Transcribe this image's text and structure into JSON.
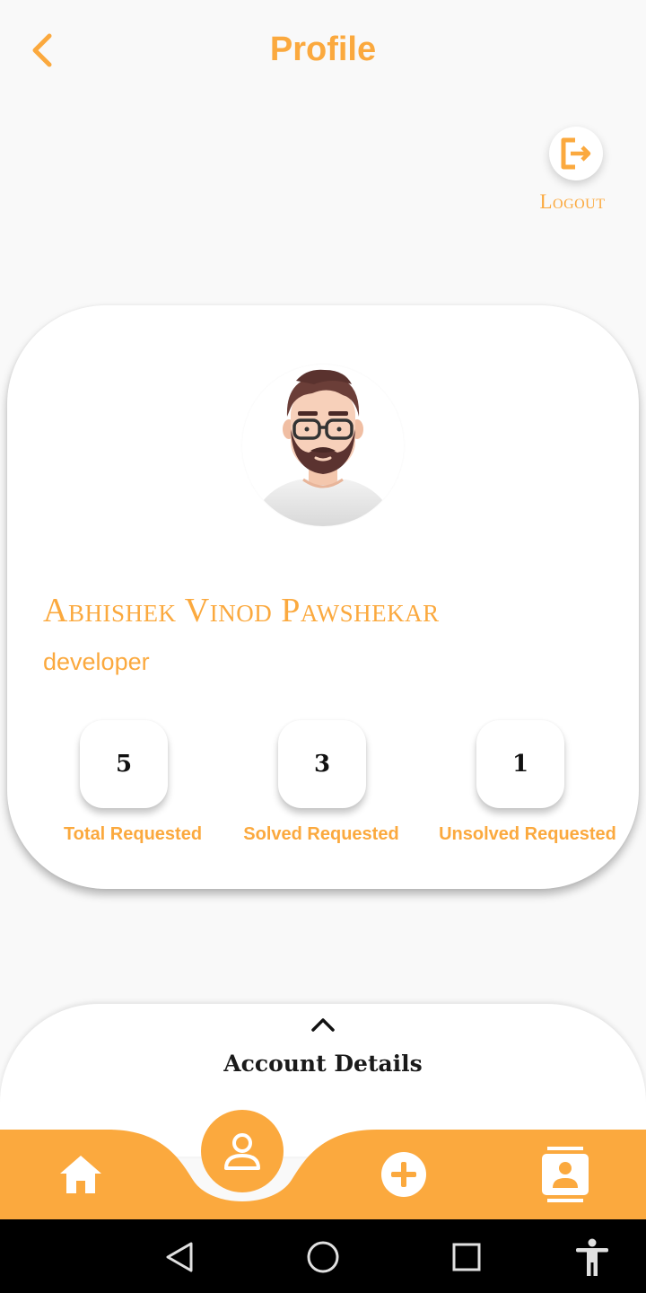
{
  "header": {
    "title": "Profile",
    "back_icon": "chevron-left-icon"
  },
  "logout": {
    "label": "Logout",
    "icon": "logout-icon"
  },
  "profile": {
    "name": "Abhishek Vinod Pawshekar",
    "role": "developer",
    "avatar_icon": "bearded-man-avatar"
  },
  "stats": [
    {
      "value": "5",
      "label": "Total Requested"
    },
    {
      "value": "3",
      "label": "Solved Requested"
    },
    {
      "value": "1",
      "label": "Unsolved Requested"
    }
  ],
  "account_sheet": {
    "title": "Account Details",
    "expand_icon": "chevron-up-icon"
  },
  "bottom_nav": {
    "items": [
      {
        "icon": "home-icon"
      },
      {
        "icon": "person-icon",
        "active": true
      },
      {
        "icon": "add-circle-icon"
      },
      {
        "icon": "contact-card-icon"
      }
    ]
  },
  "system_nav": {
    "items": [
      "back-triangle-icon",
      "home-circle-icon",
      "recents-square-icon",
      "accessibility-icon"
    ]
  },
  "colors": {
    "accent": "#fba93e",
    "background": "#f9f9f9",
    "card": "#ffffff",
    "text_dark": "#111111",
    "system_bar": "#000000"
  }
}
